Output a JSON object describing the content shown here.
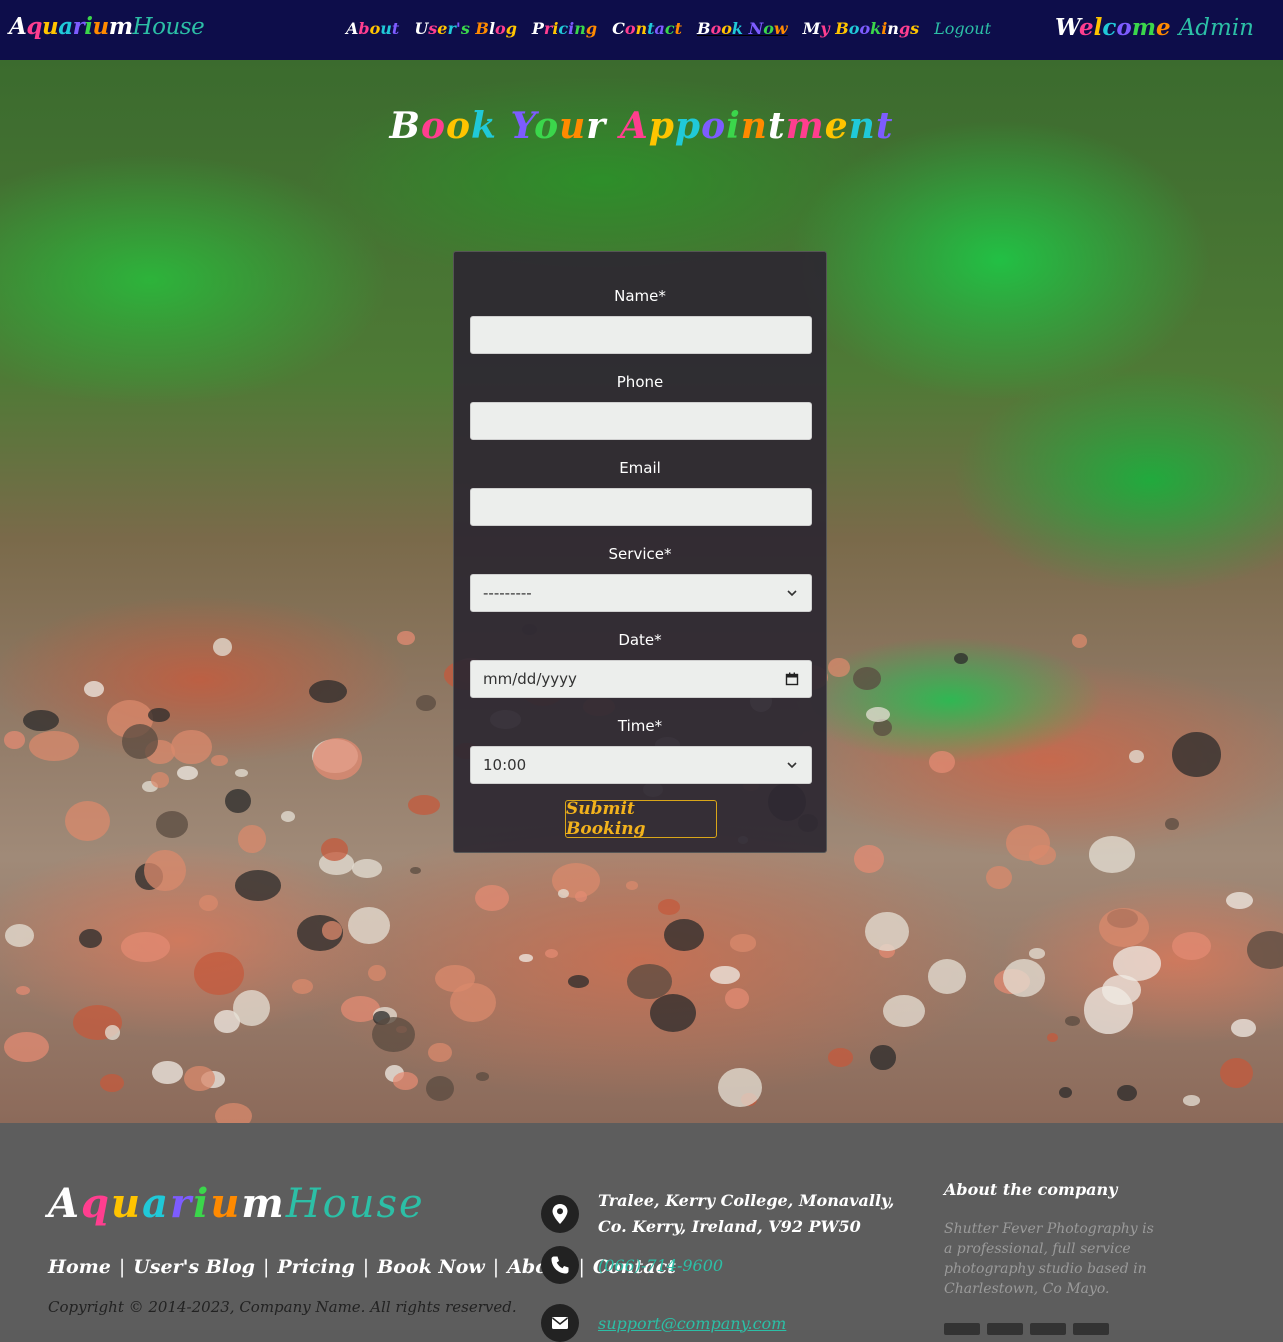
{
  "colors": {
    "nav_bg": "#0d0d4a",
    "accent_teal": "#2cbfa6",
    "button_gold": "#f2b21c",
    "footer_bg": "#5d5d5d",
    "rainbow": [
      "#ffffff",
      "#ff3e8f",
      "#ffc400",
      "#20c9d8",
      "#7d5cff",
      "#3bd64b",
      "#ff8a00"
    ]
  },
  "navbar": {
    "brand_part1": "Aquarium",
    "brand_part2": "House",
    "links": [
      "About",
      "User's Blog",
      "Pricing",
      "Contact",
      "Book Now",
      "My Bookings",
      "Logout"
    ],
    "active_link": "Book Now",
    "welcome_prefix": "Welcome",
    "welcome_user": "Admin"
  },
  "page": {
    "title": "Book Your Appointment"
  },
  "form": {
    "name_label": "Name*",
    "name_value": "",
    "phone_label": "Phone",
    "phone_value": "",
    "email_label": "Email",
    "email_value": "",
    "service_label": "Service*",
    "service_value": "---------",
    "date_label": "Date*",
    "date_value": "mm/dd/yyyy",
    "time_label": "Time*",
    "time_value": "10:00",
    "submit_label": "Submit Booking"
  },
  "footer": {
    "brand_part1": "Aquarium",
    "brand_part2": "House",
    "links": [
      "Home",
      "User's Blog",
      "Pricing",
      "Book Now",
      "About",
      "Contact"
    ],
    "copyright": "Copyright © 2014-2023, Company Name. All rights reserved.",
    "address_line1": "Tralee, Kerry College, Monavally,",
    "address_line2": "Co. Kerry, Ireland, V92 PW50",
    "phone": "(066)-714-9600",
    "email": "support@company.com",
    "about_title": "About the company",
    "about_text": "Shutter Fever Photography is a professional, full service photography studio based in Charlestown, Co Mayo."
  },
  "icons": {
    "location": "map-pin-icon",
    "phone": "phone-icon",
    "email": "envelope-icon",
    "select": "chevron-down-icon",
    "calendar": "calendar-icon"
  }
}
